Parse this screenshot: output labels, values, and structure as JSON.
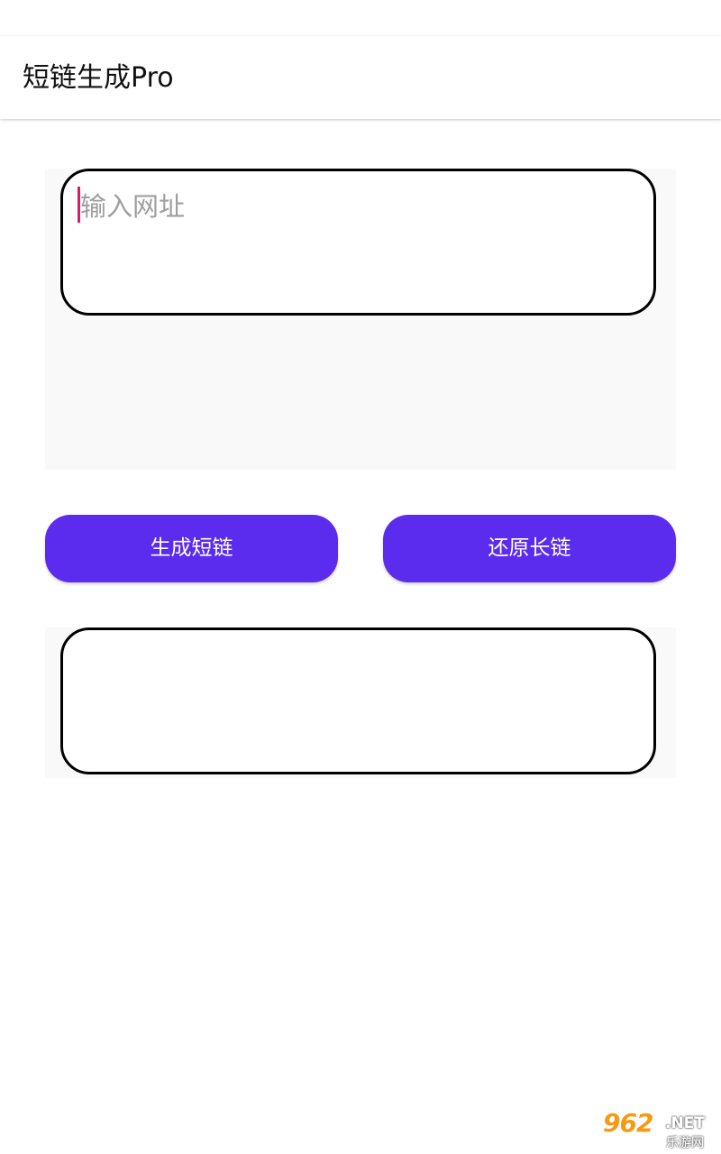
{
  "app_bar": {
    "title": "短链生成Pro"
  },
  "url_input": {
    "placeholder": "输入网址",
    "value": ""
  },
  "buttons": {
    "generate_label": "生成短链",
    "restore_label": "还原长链"
  },
  "result": {
    "text": ""
  },
  "colors": {
    "button_bg": "#5b2bee",
    "cursor": "#d81b60",
    "panel_bg": "#f9f9f9"
  },
  "watermark": {
    "main": "962",
    "suffix": ".NET",
    "sub": "乐游网"
  }
}
